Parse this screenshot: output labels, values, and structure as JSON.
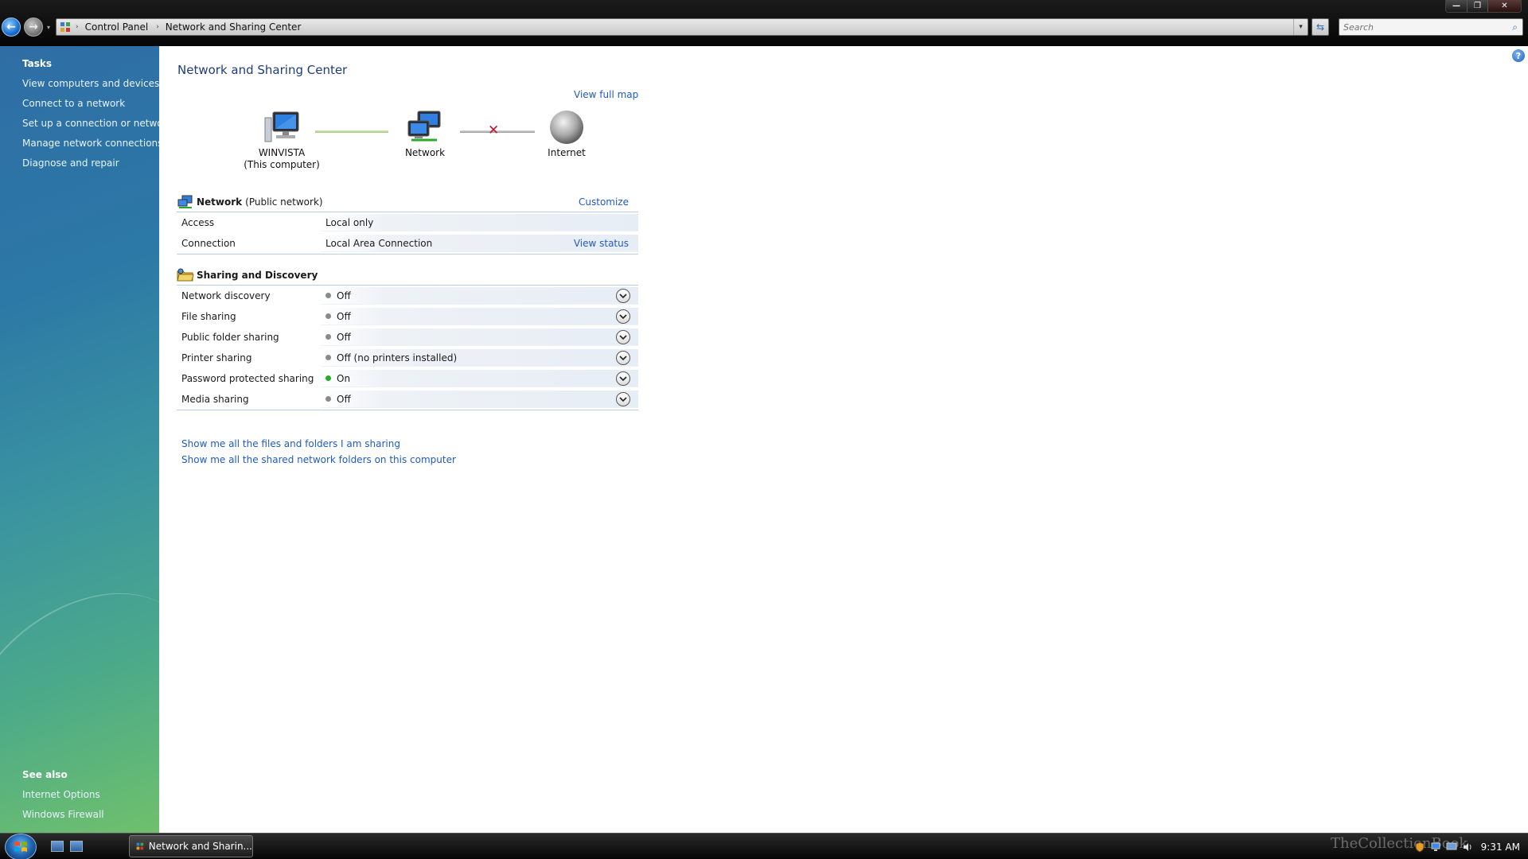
{
  "window": {
    "minimize": "—",
    "maximize": "❐",
    "close": "✕"
  },
  "nav": {
    "back": "←",
    "forward": "→",
    "history": "▾"
  },
  "address": {
    "crumbs": [
      "Control Panel",
      "Network and Sharing Center"
    ],
    "separator": "›",
    "dropdown": "▾",
    "refresh": "⇆"
  },
  "search": {
    "placeholder": "Search",
    "icon": "⌕"
  },
  "sidebar": {
    "tasks_heading": "Tasks",
    "tasks": [
      "View computers and devices",
      "Connect to a network",
      "Set up a connection or network",
      "Manage network connections",
      "Diagnose and repair"
    ],
    "see_also_heading": "See also",
    "see_also": [
      "Internet Options",
      "Windows Firewall"
    ]
  },
  "main": {
    "help": "?",
    "title": "Network and Sharing Center",
    "view_full_map": "View full map",
    "map": {
      "computer_name": "WINVISTA",
      "computer_sub": "(This computer)",
      "network": "Network",
      "internet": "Internet",
      "broken_mark": "✕"
    },
    "network_section": {
      "name": "Network",
      "type": "(Public network)",
      "customize": "Customize",
      "rows": [
        {
          "key": "Access",
          "value": "Local only"
        },
        {
          "key": "Connection",
          "value": "Local Area Connection",
          "link": "View status"
        }
      ]
    },
    "sharing_section": {
      "name": "Sharing and Discovery",
      "rows": [
        {
          "key": "Network discovery",
          "value": "Off"
        },
        {
          "key": "File sharing",
          "value": "Off"
        },
        {
          "key": "Public folder sharing",
          "value": "Off"
        },
        {
          "key": "Printer sharing",
          "value": "Off (no printers installed)"
        },
        {
          "key": "Password protected sharing",
          "value": "On"
        },
        {
          "key": "Media sharing",
          "value": "Off"
        }
      ]
    },
    "links": [
      "Show me all the files and folders I am sharing",
      "Show me all the shared network folders on this computer"
    ]
  },
  "colors": {
    "status_on": "#22b022",
    "status_off": "#8a8a8a",
    "link": "#1f5bbf",
    "title": "#1e3d7a"
  },
  "taskbar": {
    "task_label": "Network and Sharin...",
    "clock": "9:31 AM",
    "watermark": "TheCollectionBook"
  }
}
